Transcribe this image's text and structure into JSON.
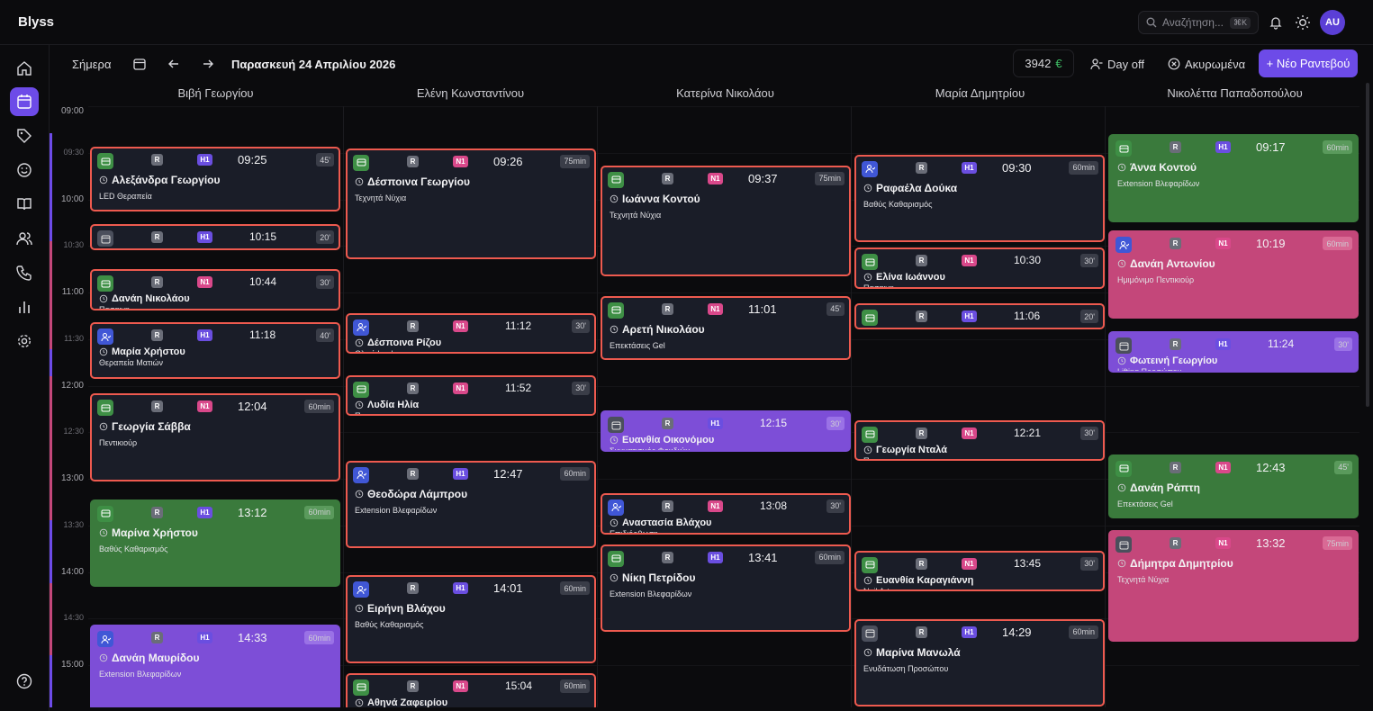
{
  "app": {
    "name": "Blyss"
  },
  "topbar": {
    "search_placeholder": "Αναζήτηση...",
    "search_shortcut": "⌘K",
    "avatar": "AU"
  },
  "toolbar": {
    "today": "Σήμερα",
    "date": "Παρασκευή 24 Απριλίου 2026",
    "revenue": "3942",
    "currency": "€",
    "day_off": "Day off",
    "cancelled": "Ακυρωμένα",
    "new_appointment": "+ Νέο Ραντεβού"
  },
  "staff": [
    "Βιβή Γεωργίου",
    "Ελένη Κωνσταντίνου",
    "Κατερίνα Νικολάου",
    "Μαρία Δημητρίου",
    "Νικολέττα Παπαδοπούλου"
  ],
  "times": [
    "09:00",
    "09:30",
    "10:00",
    "10:30",
    "11:00",
    "11:30",
    "12:00",
    "12:30",
    "13:00",
    "13:30",
    "14:00",
    "14:30",
    "15:00"
  ],
  "colors": {
    "accent": "#6d4be8",
    "green": "#3a7a3c",
    "violet": "#7d4ed7",
    "pink": "#c4477a",
    "border_red": "#ee5a4f"
  },
  "appointments": [
    {
      "col": 0,
      "time": "09:25",
      "dur": "45'",
      "client": "Αλεξάνδρα Γεωργίου",
      "service": "LED Θεραπεία",
      "color": "dark",
      "icon": "g",
      "level": "H1"
    },
    {
      "col": 0,
      "time": "10:15",
      "dur": "20'",
      "client": "",
      "service": "",
      "color": "dark",
      "icon": "s",
      "level": "H1"
    },
    {
      "col": 0,
      "time": "10:44",
      "dur": "30'",
      "client": "Δανάη Νικολάου",
      "service": "Πασαινη",
      "color": "dark",
      "icon": "g",
      "level": "N1"
    },
    {
      "col": 0,
      "time": "11:18",
      "dur": "40'",
      "client": "Μαρία Χρήστου",
      "service": "Θεραπεία Ματιών",
      "color": "dark",
      "icon": "b",
      "level": "H1"
    },
    {
      "col": 0,
      "time": "12:04",
      "dur": "60min",
      "client": "Γεωργία Σάββα",
      "service": "Πεντικιούρ",
      "color": "dark",
      "icon": "g",
      "level": "N1"
    },
    {
      "col": 0,
      "time": "13:12",
      "dur": "60min",
      "client": "Μαρίνα Χρήστου",
      "service": "Βαθύς Καθαρισμός",
      "color": "green",
      "icon": "g",
      "level": "H1"
    },
    {
      "col": 0,
      "time": "14:33",
      "dur": "60min",
      "client": "Δανάη Μαυρίδου",
      "service": "Extension Βλεφαρίδων",
      "color": "violet",
      "icon": "b",
      "level": "H1"
    },
    {
      "col": 1,
      "time": "09:26",
      "dur": "75min",
      "client": "Δέσποινα Γεωργίου",
      "service": "Τεχνητά Νύχια",
      "color": "dark",
      "icon": "g",
      "level": "N1"
    },
    {
      "col": 1,
      "time": "11:12",
      "dur": "30'",
      "client": "Δέσποινα Ρίζου",
      "service": "Ολικό Look",
      "color": "dark",
      "icon": "b",
      "level": "N1"
    },
    {
      "col": 1,
      "time": "11:52",
      "dur": "30'",
      "client": "Λυδία Ηλία",
      "service": "Πασαινη",
      "color": "dark",
      "icon": "g",
      "level": "N1"
    },
    {
      "col": 1,
      "time": "12:47",
      "dur": "60min",
      "client": "Θεοδώρα Λάμπρου",
      "service": "Extension Βλεφαρίδων",
      "color": "dark",
      "icon": "b",
      "level": "H1"
    },
    {
      "col": 1,
      "time": "14:01",
      "dur": "60min",
      "client": "Ειρήνη Βλάχου",
      "service": "Βαθύς Καθαρισμός",
      "color": "dark",
      "icon": "b",
      "level": "H1"
    },
    {
      "col": 1,
      "time": "15:04",
      "dur": "60min",
      "client": "Αθηνά Ζαφειρίου",
      "service": "",
      "color": "dark",
      "icon": "g",
      "level": "N1"
    },
    {
      "col": 2,
      "time": "09:37",
      "dur": "75min",
      "client": "Ιωάννα Κοντού",
      "service": "Τεχνητά Νύχια",
      "color": "dark",
      "icon": "g",
      "level": "N1"
    },
    {
      "col": 2,
      "time": "11:01",
      "dur": "45'",
      "client": "Αρετή Νικολάου",
      "service": "Επεκτάσεις Gel",
      "color": "dark",
      "icon": "g",
      "level": "N1"
    },
    {
      "col": 2,
      "time": "12:15",
      "dur": "30'",
      "client": "Ευανθία Οικονόμου",
      "service": "Συνματισμός Φουδιών",
      "color": "violet",
      "icon": "s",
      "level": "H1"
    },
    {
      "col": 2,
      "time": "13:08",
      "dur": "30'",
      "client": "Αναστασία Βλάχου",
      "service": "Επιδιόρθωση",
      "color": "dark",
      "icon": "b",
      "level": "N1"
    },
    {
      "col": 2,
      "time": "13:41",
      "dur": "60min",
      "client": "Νίκη Πετρίδου",
      "service": "Extension Βλεφαρίδων",
      "color": "dark",
      "icon": "g",
      "level": "H1"
    },
    {
      "col": 3,
      "time": "09:30",
      "dur": "60min",
      "client": "Ραφαέλα Δούκα",
      "service": "Βαθύς Καθαρισμός",
      "color": "dark",
      "icon": "b",
      "level": "H1"
    },
    {
      "col": 3,
      "time": "10:30",
      "dur": "30'",
      "client": "Ελίνα Ιωάννου",
      "service": "Πασαινη",
      "color": "dark",
      "icon": "g",
      "level": "N1"
    },
    {
      "col": 3,
      "time": "11:06",
      "dur": "20'",
      "client": "",
      "service": "",
      "color": "dark",
      "icon": "g",
      "level": "H1"
    },
    {
      "col": 3,
      "time": "12:21",
      "dur": "30'",
      "client": "Γεωργία Νταλά",
      "service": "Πασαινη",
      "color": "dark",
      "icon": "g",
      "level": "N1"
    },
    {
      "col": 3,
      "time": "13:45",
      "dur": "30'",
      "client": "Ευανθία Καραγιάννη",
      "service": "Nail Art",
      "color": "dark",
      "icon": "g",
      "level": "N1"
    },
    {
      "col": 3,
      "time": "14:29",
      "dur": "60min",
      "client": "Μαρίνα Μανωλά",
      "service": "Ενυδάτωση Προσώπου",
      "color": "dark",
      "icon": "s",
      "level": "H1"
    },
    {
      "col": 4,
      "time": "09:17",
      "dur": "60min",
      "client": "Άννα Κοντού",
      "service": "Extension Βλεφαρίδων",
      "color": "green",
      "icon": "g",
      "level": "H1"
    },
    {
      "col": 4,
      "time": "10:19",
      "dur": "60min",
      "client": "Δανάη Αντωνίου",
      "service": "Ημιμόνιμο Πεντικιούρ",
      "color": "pink",
      "icon": "b",
      "level": "N1"
    },
    {
      "col": 4,
      "time": "11:24",
      "dur": "30'",
      "client": "Φωτεινή Γεωργίου",
      "service": "Lifting Προσώπου",
      "color": "violet",
      "icon": "s",
      "level": "H1"
    },
    {
      "col": 4,
      "time": "12:43",
      "dur": "45'",
      "client": "Δανάη Ράπτη",
      "service": "Επεκτάσεις Gel",
      "color": "green",
      "icon": "g",
      "level": "N1"
    },
    {
      "col": 4,
      "time": "13:32",
      "dur": "75min",
      "client": "Δήμητρα Δημητρίου",
      "service": "Τεχνητά Νύχια",
      "color": "pink",
      "icon": "s",
      "level": "N1"
    }
  ]
}
